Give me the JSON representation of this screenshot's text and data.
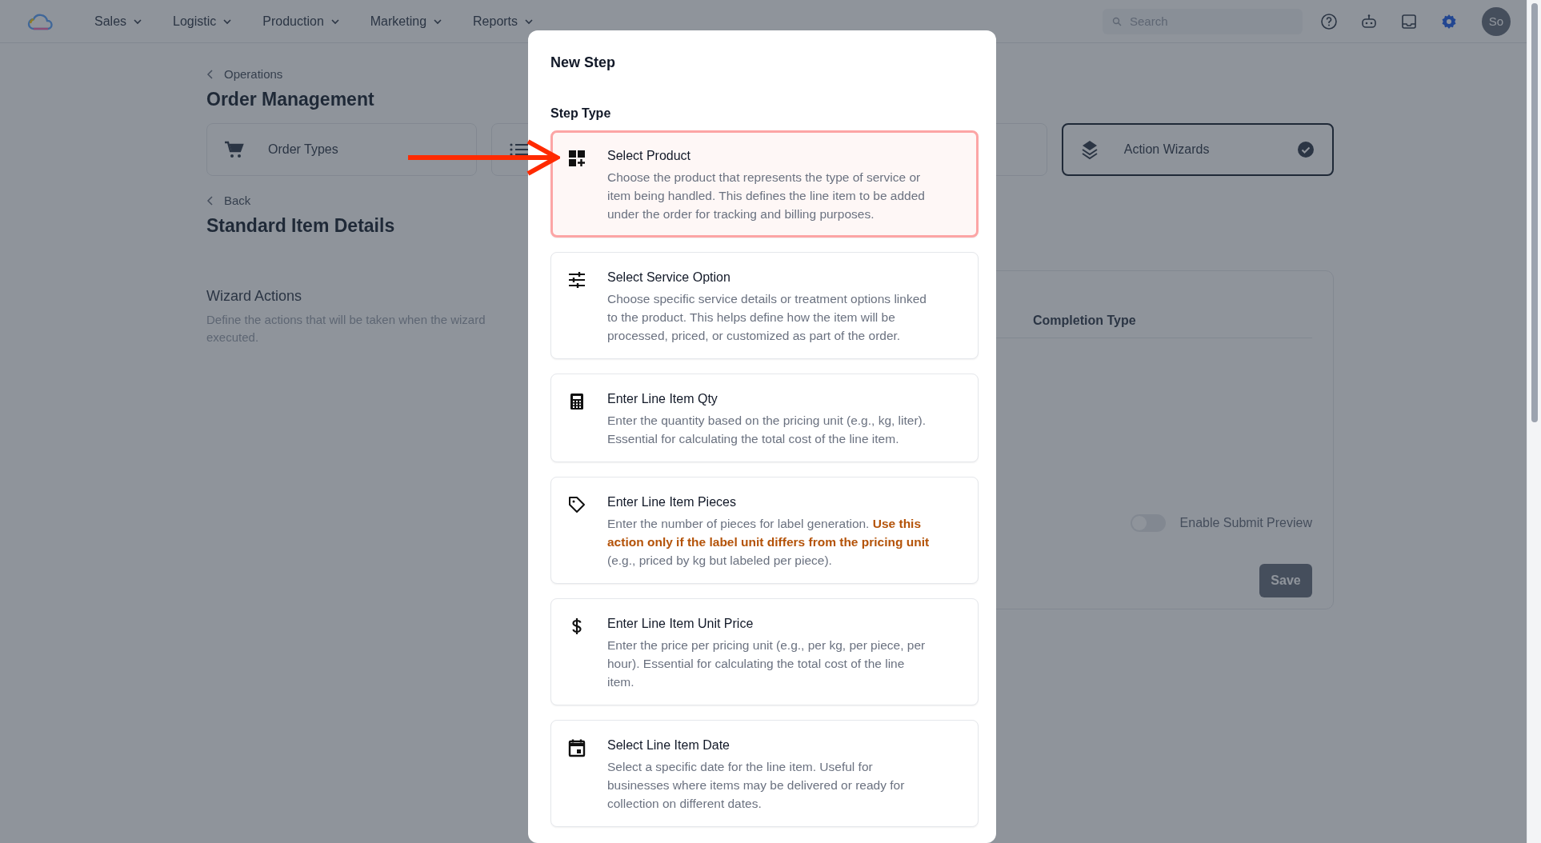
{
  "nav": {
    "menus": [
      {
        "label": "Sales"
      },
      {
        "label": "Logistic"
      },
      {
        "label": "Production"
      },
      {
        "label": "Marketing"
      },
      {
        "label": "Reports"
      }
    ],
    "search": {
      "placeholder": "Search"
    },
    "avatar": "So"
  },
  "page": {
    "breadcrumb": "Operations",
    "title": "Order Management",
    "tiles": [
      {
        "label": "Order Types",
        "selected": false
      },
      {
        "selected": false
      },
      {
        "selected": false
      },
      {
        "label": "Action Wizards",
        "selected": true
      }
    ],
    "back": "Back",
    "subtitle": "Standard Item Details",
    "section": {
      "title": "Wizard Actions",
      "description": "Define the actions that will be taken when the wizard executed."
    },
    "panel": {
      "column": "Completion Type",
      "toggle": {
        "label": "Enable Submit Preview",
        "on": false
      },
      "save": "Save"
    }
  },
  "modal": {
    "title": "New Step",
    "label": "Step Type",
    "steps": [
      {
        "title": "Select Product",
        "description": "Choose the product that represents the type of service or item being handled. This defines the line item to be added under the order for tracking and billing purposes.",
        "selected": true
      },
      {
        "title": "Select Service Option",
        "description": "Choose specific service details or treatment options linked to the product. This helps define how the item will be processed, priced, or customized as part of the order.",
        "selected": false
      },
      {
        "title": "Enter Line Item Qty",
        "description": "Enter the quantity based on the pricing unit (e.g., kg, liter). Essential for calculating the total cost of the line item.",
        "selected": false
      },
      {
        "title": "Enter Line Item Pieces",
        "description": "Enter the number of pieces for label generation. **Use this action only if the label unit differs from the pricing unit** (e.g., priced by kg but labeled per piece).",
        "selected": false
      },
      {
        "title": "Enter Line Item Unit Price",
        "description": "Enter the price per pricing unit (e.g., per kg, per piece, per hour). Essential for calculating the total cost of the line item.",
        "selected": false
      },
      {
        "title": "Select Line Item Date",
        "description": "Select a specific date for the line item. Useful for businesses where items may be delivered or ready for collection on different dates.",
        "selected": false
      }
    ]
  }
}
